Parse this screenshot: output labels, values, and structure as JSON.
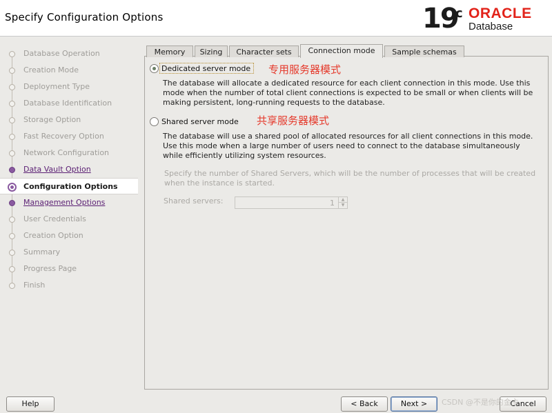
{
  "header": {
    "title": "Specify Configuration Options",
    "logo": {
      "version": "19",
      "superscript": "c",
      "brand": "ORACLE",
      "product": "Database"
    }
  },
  "steps": [
    {
      "label": "Database Operation",
      "state": "done"
    },
    {
      "label": "Creation Mode",
      "state": "done"
    },
    {
      "label": "Deployment Type",
      "state": "done"
    },
    {
      "label": "Database Identification",
      "state": "done"
    },
    {
      "label": "Storage Option",
      "state": "done"
    },
    {
      "label": "Fast Recovery Option",
      "state": "done"
    },
    {
      "label": "Network Configuration",
      "state": "done"
    },
    {
      "label": "Data Vault Option",
      "state": "link"
    },
    {
      "label": "Configuration Options",
      "state": "current"
    },
    {
      "label": "Management Options",
      "state": "link"
    },
    {
      "label": "User Credentials",
      "state": "pending"
    },
    {
      "label": "Creation Option",
      "state": "pending"
    },
    {
      "label": "Summary",
      "state": "pending"
    },
    {
      "label": "Progress Page",
      "state": "pending"
    },
    {
      "label": "Finish",
      "state": "pending"
    }
  ],
  "tabs": [
    {
      "label": "Memory",
      "active": false
    },
    {
      "label": "Sizing",
      "active": false
    },
    {
      "label": "Character sets",
      "active": false
    },
    {
      "label": "Connection mode",
      "active": true
    },
    {
      "label": "Sample schemas",
      "active": false
    }
  ],
  "connection_mode": {
    "dedicated": {
      "label": "Dedicated server mode",
      "selected": true,
      "annotation": "专用服务器模式",
      "description": "The database will allocate a dedicated resource for each client connection in this mode. Use this mode when the number of total client connections is expected to be small or when clients will be making persistent, long-running requests to the database."
    },
    "shared": {
      "label": "Shared server mode",
      "selected": false,
      "annotation": "共享服务器模式",
      "description": "The database will use a shared pool of allocated resources for all client connections in this mode.  Use this mode when a large number of users need to connect to the database simultaneously while efficiently utilizing system resources."
    },
    "shared_servers_hint": "Specify the number of Shared Servers, which will be the number of processes that will be created when the instance is started.",
    "shared_servers_label": "Shared servers:",
    "shared_servers_value": "1"
  },
  "buttons": {
    "help": "Help",
    "back": "< Back",
    "next": "Next >",
    "cancel": "Cancel"
  },
  "watermark": "CSDN @不是你的金主"
}
